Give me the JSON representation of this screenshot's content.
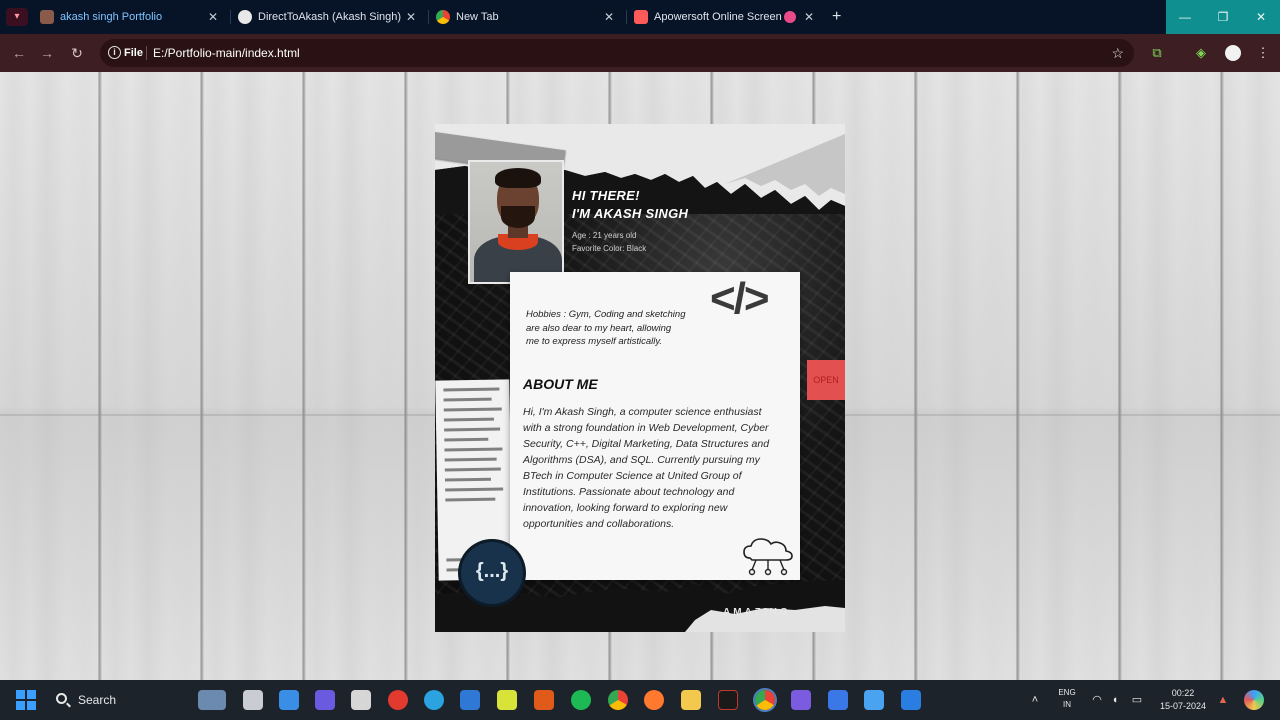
{
  "browser": {
    "menu_icon": "profile-chevron-icon",
    "tabs": [
      {
        "title": "akash singh Portfolio",
        "favicon": "portfolio-favicon",
        "active": true
      },
      {
        "title": "DirectToAkash (Akash Singh)",
        "favicon": "github-icon",
        "active": false
      },
      {
        "title": "New Tab",
        "favicon": "chrome-icon",
        "active": false
      },
      {
        "title": "Apowersoft Online Screen R",
        "favicon": "apowersoft-icon",
        "active": false
      }
    ],
    "new_tab_label": "+",
    "window_controls": {
      "minimize": "—",
      "restore": "❐",
      "close": "✕"
    },
    "address": {
      "scheme_label": "File",
      "url": "E:/Portfolio-main/index.html"
    }
  },
  "page": {
    "greeting_line1": "HI THERE!",
    "greeting_line2": "I'M AKASH SINGH",
    "age": "Age : 21 years old",
    "favorite_color": "Favorite Color: Black",
    "hobbies": "Hobbies : Gym, Coding and sketching are also dear to my heart, allowing me to express myself artistically.",
    "code_symbol": "</>",
    "about_title": "ABOUT ME",
    "about_text": "Hi, I'm Akash Singh, a computer science enthusiast with a strong foundation in Web Development, Cyber Security, C++, Digital Marketing, Data Structures and Algorithms (DSA), and SQL. Currently pursuing my BTech in Computer Science at United Group of Institutions. Passionate about technology and innovation, looking forward to exploring new opportunities and collaborations.",
    "open_button": "OPEN",
    "braces_badge": "{...}",
    "footer_word": "AMAZING"
  },
  "taskbar": {
    "search_label": "Search",
    "language": "ENG",
    "region": "IN",
    "time": "00:22",
    "date": "15-07-2024"
  },
  "colors": {
    "tab_strip": "#071427",
    "toolbar": "#3d1e22",
    "accent_teal": "#0f8f8f",
    "card_dark": "#111111",
    "open_red": "#e2514f"
  }
}
